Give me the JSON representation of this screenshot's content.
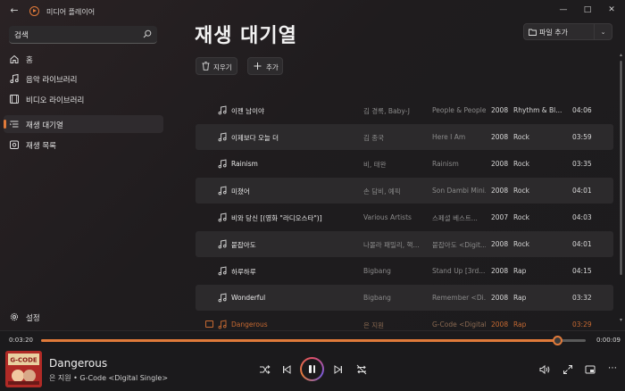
{
  "window": {
    "title": "미디어 플레이어",
    "back_icon": "back-arrow-icon",
    "minimize": "—",
    "maximize": "□",
    "close": "✕"
  },
  "sidebar": {
    "search_value": "검색",
    "items": [
      {
        "label": "홈",
        "icon": "home-icon",
        "active": false
      },
      {
        "label": "음악 라이브러리",
        "icon": "music-note-icon",
        "active": false
      },
      {
        "label": "비디오 라이브러리",
        "icon": "video-icon",
        "active": false
      },
      {
        "label": "재생 대기열",
        "icon": "queue-icon",
        "active": true
      },
      {
        "label": "재생 목록",
        "icon": "playlist-icon",
        "active": false
      }
    ],
    "settings_label": "설정"
  },
  "main": {
    "title": "재생 대기열",
    "add_file_label": "파일 추가",
    "clear_label": "지우기",
    "add_label": "추가"
  },
  "queue": [
    {
      "title": "이젠 남이야",
      "artist": "김 경록, Baby-J",
      "album": "People & People",
      "year": "2008",
      "genre": "Rhythm & Bl...",
      "duration": "04:06"
    },
    {
      "title": "이제보다 오늘 더",
      "artist": "김 종국",
      "album": "Here I Am",
      "year": "2008",
      "genre": "Rock",
      "duration": "03:59"
    },
    {
      "title": "Rainism",
      "artist": "비, 태완",
      "album": "Rainism",
      "year": "2008",
      "genre": "Rock",
      "duration": "03:35"
    },
    {
      "title": "미쳤어",
      "artist": "손 담비, 예픽",
      "album": "Son Dambi Mini...",
      "year": "2008",
      "genre": "Rock",
      "duration": "04:01"
    },
    {
      "title": "비와 당신 [(영화 \"라디오스타\")]",
      "artist": "Various Artists",
      "album": "스페셜 베스트...",
      "year": "2007",
      "genre": "Rock",
      "duration": "04:03"
    },
    {
      "title": "붙잡아도",
      "artist": "나몰라 패밀리, 핵...",
      "album": "붙잡아도 <Digit...",
      "year": "2008",
      "genre": "Rock",
      "duration": "04:01"
    },
    {
      "title": "하루하루",
      "artist": "Bigbang",
      "album": "Stand Up [3rd...",
      "year": "2008",
      "genre": "Rap",
      "duration": "04:15"
    },
    {
      "title": "Wonderful",
      "artist": "Bigbang",
      "album": "Remember <Di...",
      "year": "2008",
      "genre": "Rap",
      "duration": "03:32"
    },
    {
      "title": "Dangerous",
      "artist": "은 지원",
      "album": "G-Code <Digital...",
      "year": "2008",
      "genre": "Rap",
      "duration": "03:29",
      "playing": true
    }
  ],
  "player": {
    "current_time": "0:03:20",
    "total_time": "0:00:09",
    "progress": 0.948,
    "track_title": "Dangerous",
    "track_subtitle": "은 지원 • G-Code <Digital Single>",
    "album_art_text": "G-CODE"
  },
  "colors": {
    "accent": "#e07a3a",
    "background": "#1d1a1c",
    "row_alt": "#2c2a2c"
  }
}
